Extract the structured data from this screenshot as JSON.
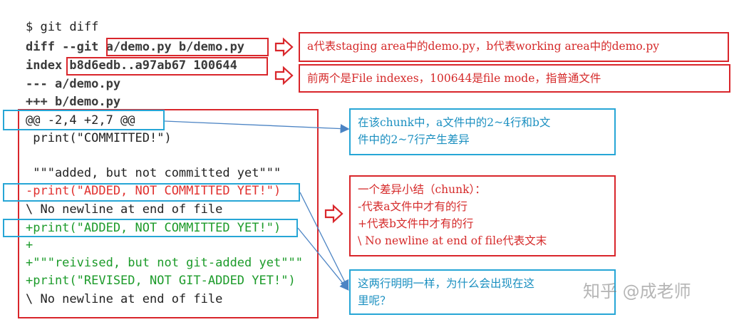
{
  "code_lines": [
    {
      "text": "$ git diff",
      "style": "plain"
    },
    {
      "text": "diff --git a/demo.py b/demo.py",
      "style": "dark"
    },
    {
      "text": "index b8d6edb..a97ab67 100644",
      "style": "dark"
    },
    {
      "text": "--- a/demo.py",
      "style": "dark"
    },
    {
      "text": "+++ b/demo.py",
      "style": "dark"
    },
    {
      "text": "@@ -2,4 +2,7 @@",
      "style": "plain"
    },
    {
      "text": " print(\"COMMITTED!\")",
      "style": "plain"
    },
    {
      "text": "",
      "style": "plain"
    },
    {
      "text": " \"\"\"added, but not committed yet\"\"\"",
      "style": "plain"
    },
    {
      "text": "-print(\"ADDED, NOT COMMITTED YET!\")",
      "style": "red"
    },
    {
      "text": "\\ No newline at end of file",
      "style": "plain"
    },
    {
      "text": "+print(\"ADDED, NOT COMMITTED YET!\")",
      "style": "green"
    },
    {
      "text": "+",
      "style": "green"
    },
    {
      "text": "+\"\"\"reivised, but not git-added yet\"\"\"",
      "style": "green"
    },
    {
      "text": "+print(\"REVISED, NOT GIT-ADDED YET!\")",
      "style": "green"
    },
    {
      "text": "\\ No newline at end of file",
      "style": "plain"
    }
  ],
  "notes": {
    "staging": "a代表staging area中的demo.py，b代表working area中的demo.py",
    "index": "前两个是File indexes，100644是file mode，指普通文件",
    "chunk_range": [
      "在该chunk中，a文件中的2~4行和b文",
      "件中的2~7行产生差异"
    ],
    "chunk_summary": [
      "一个差异小结（chunk）：",
      "-代表a文件中才有的行",
      "+代表b文件中才有的行",
      "\\ No newline at end of file代表文末"
    ],
    "question": [
      "这两行明明一样，为什么会出现在这",
      "里呢？"
    ]
  },
  "watermark": "知乎 @成老师",
  "colors": {
    "red": "#d9262b",
    "blue": "#27a6d6",
    "code_red": "#e0312f",
    "code_green": "#1c9b2a"
  }
}
